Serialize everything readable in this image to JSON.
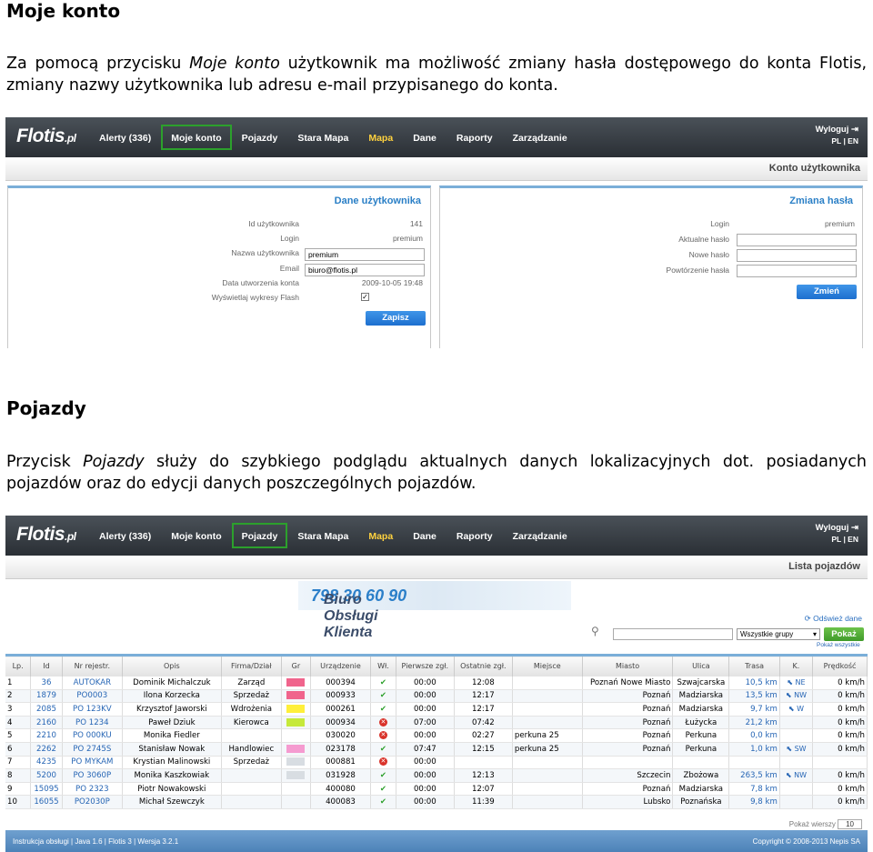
{
  "section1": {
    "heading": "Moje konto",
    "para_before": "Za pomocą przycisku ",
    "para_em": "Moje konto",
    "para_after": " użytkownik ma możliwość zmiany hasła dostępowego do konta Flotis, zmiany nazwy użytkownika lub adresu e-mail przypisanego do konta."
  },
  "section2": {
    "heading": "Pojazdy",
    "para_before": "Przycisk ",
    "para_em": "Pojazdy",
    "para_after": " służy do szybkiego podglądu aktualnych danych lokalizacyjnych dot. posiadanych pojazdów oraz do edycji danych poszczególnych pojazdów."
  },
  "app": {
    "logo": "Flotis",
    "logo_suffix": ".pl",
    "nav": [
      "Alerty (336)",
      "Moje konto",
      "Pojazdy",
      "Stara Mapa",
      "Mapa",
      "Dane",
      "Raporty",
      "Zarządzanie"
    ],
    "logout": "Wyloguj",
    "lang": "PL | EN"
  },
  "account": {
    "subtitle": "Konto użytkownika",
    "user_panel": {
      "title": "Dane użytkownika",
      "labels": [
        "Id użytkownika",
        "Login",
        "Nazwa użytkownika",
        "Email",
        "Data utworzenia konta",
        "Wyświetlaj wykresy Flash"
      ],
      "id": "141",
      "login": "premium",
      "username": "premium",
      "email": "biuro@flotis.pl",
      "created": "2009-10-05 19:48",
      "save": "Zapisz"
    },
    "pass_panel": {
      "title": "Zmiana hasła",
      "labels": [
        "Login",
        "Aktualne hasło",
        "Nowe hasło",
        "Powtórzenie hasła"
      ],
      "login": "premium",
      "change": "Zmień"
    }
  },
  "vehicles": {
    "subtitle": "Lista pojazdów",
    "banner_text": "Biuro Obsługi Klienta",
    "banner_phone": "798 30 60 90",
    "refresh": "Odśwież dane",
    "group_select": "Wszystkie grupy",
    "show_btn": "Pokaż",
    "show_all": "Pokaż wszystkie",
    "columns": [
      "Lp.",
      "Id",
      "Nr rejestr.",
      "Opis",
      "Firma/Dział",
      "Gr",
      "Urządzenie",
      "Wł.",
      "Pierwsze zgł.",
      "Ostatnie zgł.",
      "Miejsce",
      "Miasto",
      "Ulica",
      "Trasa",
      "K.",
      "Prędkość"
    ],
    "rows": [
      {
        "lp": "1",
        "id": "36",
        "reg": "AUTOKAR",
        "desc": "Dominik Michalczuk",
        "firm": "Zarząd",
        "gr": "#f0648c",
        "dev": "000394",
        "on": "ok",
        "first": "00:00",
        "last": "12:08",
        "place": "",
        "city": "Poznań Nowe Miasto",
        "street": "Szwajcarska",
        "route": "10,5 km",
        "dir": "NE",
        "speed": "0 km/h"
      },
      {
        "lp": "2",
        "id": "1879",
        "reg": "PO0003",
        "desc": "Ilona Korzecka",
        "firm": "Sprzedaż",
        "gr": "#f0648c",
        "dev": "000933",
        "on": "ok",
        "first": "00:00",
        "last": "12:17",
        "place": "",
        "city": "Poznań",
        "street": "Madziarska",
        "route": "13,5 km",
        "dir": "NW",
        "speed": "0 km/h"
      },
      {
        "lp": "3",
        "id": "2085",
        "reg": "PO 123KV",
        "desc": "Krzysztof Jaworski",
        "firm": "Wdrożenia",
        "gr": "#ffef3a",
        "dev": "000261",
        "on": "ok",
        "first": "00:00",
        "last": "12:17",
        "place": "",
        "city": "Poznań",
        "street": "Madziarska",
        "route": "9,7 km",
        "dir": "W",
        "speed": "0 km/h"
      },
      {
        "lp": "4",
        "id": "2160",
        "reg": "PO 1234",
        "desc": "Paweł Dziuk",
        "firm": "Kierowca",
        "gr": "#c6e93a",
        "dev": "000934",
        "on": "bad",
        "first": "07:00",
        "last": "07:42",
        "place": "",
        "city": "Poznań",
        "street": "Łużycka",
        "route": "21,2 km",
        "dir": "",
        "speed": "0 km/h"
      },
      {
        "lp": "5",
        "id": "2210",
        "reg": "PO 000KU",
        "desc": "Monika Fiedler",
        "firm": "",
        "gr": "",
        "dev": "030020",
        "on": "bad",
        "first": "00:00",
        "last": "02:27",
        "place": "perkuna 25",
        "city": "Poznań",
        "street": "Perkuna",
        "route": "0,0 km",
        "dir": "",
        "speed": "0 km/h"
      },
      {
        "lp": "6",
        "id": "2262",
        "reg": "PO 2745S",
        "desc": "Stanisław Nowak",
        "firm": "Handlowiec",
        "gr": "#f59bd0",
        "dev": "023178",
        "on": "ok",
        "first": "07:47",
        "last": "12:15",
        "place": "perkuna 25",
        "city": "Poznań",
        "street": "Perkuna",
        "route": "1,0 km",
        "dir": "SW",
        "speed": "0 km/h"
      },
      {
        "lp": "7",
        "id": "4235",
        "reg": "PO MYKAM",
        "desc": "Krystian Malinowski",
        "firm": "Sprzedaż",
        "gr": "#d8dde2",
        "dev": "000881",
        "on": "bad",
        "first": "00:00",
        "last": "",
        "place": "",
        "city": "",
        "street": "",
        "route": "",
        "dir": "",
        "speed": ""
      },
      {
        "lp": "8",
        "id": "5200",
        "reg": "PO 3060P",
        "desc": "Monika Kaszkowiak",
        "firm": "",
        "gr": "#d8dde2",
        "dev": "031928",
        "on": "ok",
        "first": "00:00",
        "last": "12:13",
        "place": "",
        "city": "Szczecin",
        "street": "Zbożowa",
        "route": "263,5 km",
        "dir": "NW",
        "speed": "0 km/h"
      },
      {
        "lp": "9",
        "id": "15095",
        "reg": "PO 2323",
        "desc": "Piotr Nowakowski",
        "firm": "",
        "gr": "",
        "dev": "400080",
        "on": "ok",
        "first": "00:00",
        "last": "12:07",
        "place": "",
        "city": "Poznań",
        "street": "Madziarska",
        "route": "7,8 km",
        "dir": "",
        "speed": "0 km/h"
      },
      {
        "lp": "10",
        "id": "16055",
        "reg": "PO2030P",
        "desc": "Michał Szewczyk",
        "firm": "",
        "gr": "",
        "dev": "400083",
        "on": "ok",
        "first": "00:00",
        "last": "11:39",
        "place": "",
        "city": "Lubsko",
        "street": "Poznańska",
        "route": "9,8 km",
        "dir": "",
        "speed": "0 km/h"
      }
    ],
    "pager_label": "Pokaż wierszy",
    "pager_value": "10",
    "footer_left": "Instrukcja obsługi | Java 1.6 | Flotis 3 | Wersja 3.2.1",
    "footer_right": "Copyright © 2008-2013 Nepis SA"
  }
}
